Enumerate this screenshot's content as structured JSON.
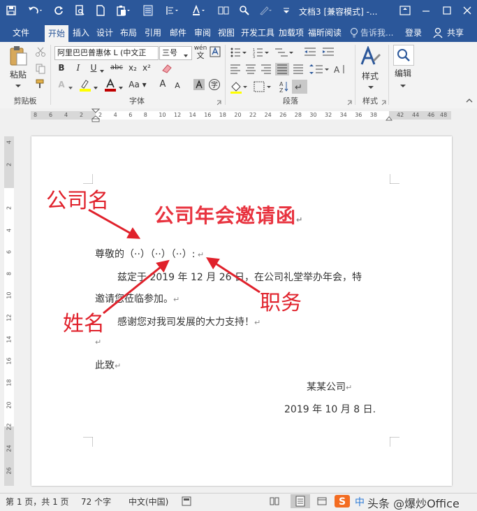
{
  "titlebar": {
    "title": "文档3 [兼容模式] -..."
  },
  "tabs": [
    "文件",
    "开始",
    "插入",
    "设计",
    "布局",
    "引用",
    "邮件",
    "审阅",
    "视图",
    "开发工具",
    "加载项",
    "福昕阅读"
  ],
  "tell_me": "告诉我...",
  "login": "登录",
  "share": "共享",
  "ribbon": {
    "paste": "粘贴",
    "font_name": "阿里巴巴普惠体 L (中文正",
    "font_size": "三号",
    "wen": "wén",
    "bold": "B",
    "italic": "I",
    "underline": "U",
    "strike": "abc",
    "sub": "x₂",
    "sup": "x²",
    "font_color": "A",
    "highlight": "A",
    "grow": "A",
    "shrink": "A",
    "style": "样式",
    "edit": "编辑",
    "groups": {
      "clipboard": "剪贴板",
      "font": "字体",
      "paragraph": "段落",
      "styles": "样式"
    }
  },
  "ruler": {
    "left": [
      "8",
      "6",
      "4",
      "2"
    ],
    "main": [
      "2",
      "4",
      "6",
      "8",
      "10",
      "12",
      "14",
      "16",
      "18",
      "20",
      "22",
      "24",
      "26",
      "28",
      "30",
      "32",
      "34",
      "36",
      "38"
    ],
    "right": [
      "42",
      "44",
      "46",
      "48"
    ],
    "vertical": [
      "4",
      "2",
      "2",
      "4",
      "6",
      "8",
      "10",
      "12",
      "14",
      "16",
      "18",
      "20",
      "22",
      "24",
      "26"
    ]
  },
  "document": {
    "title": "公司年会邀请函",
    "greeting": "尊敬的（··）（··）（··）:",
    "body1": "兹定于 2019 年 12 月 26 日，在公司礼堂举办年会，特",
    "body2": "邀请您莅临参加。",
    "body3": "感谢您对我司发展的大力支持！",
    "closing": "此致",
    "signer": "某某公司",
    "date": "2019 年 10 月 8 日."
  },
  "annotations": {
    "company": "公司名",
    "name": "姓名",
    "position": "职务"
  },
  "status": {
    "page": "第 1 页，共 1 页",
    "words": "72 个字",
    "lang": "中文(中国)"
  },
  "watermark": "头条 @爆炒Office",
  "colors": {
    "accent": "#2b579a",
    "annotation": "#e0212b",
    "title": "#e8333f"
  }
}
